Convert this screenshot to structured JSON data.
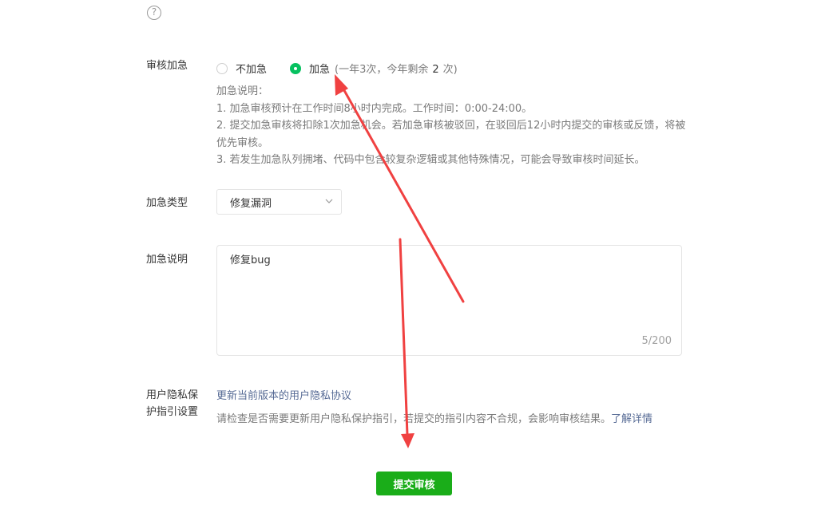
{
  "help_icon": "?",
  "urgent": {
    "label": "审核加急",
    "options": [
      {
        "label": "不加急",
        "checked": false
      },
      {
        "label": "加急",
        "checked": true
      }
    ],
    "quota_prefix": "(一年3次，今年剩余",
    "quota_count": "2",
    "quota_suffix": "次)",
    "desc_title": "加急说明：",
    "desc_lines": [
      "1. 加急审核预计在工作时间8小时内完成。工作时间：0:00-24:00。",
      "2. 提交加急审核将扣除1次加急机会。若加急审核被驳回，在驳回后12小时内提交的审核或反馈，将被优先审核。",
      "3. 若发生加急队列拥堵、代码中包含较复杂逻辑或其他特殊情况，可能会导致审核时间延长。"
    ]
  },
  "urgent_type": {
    "label": "加急类型",
    "value": "修复漏洞"
  },
  "urgent_desc": {
    "label": "加急说明",
    "value": "修复bug",
    "count": "5/200"
  },
  "privacy": {
    "label": "用户隐私保护指引设置",
    "link": "更新当前版本的用户隐私协议",
    "note": "请检查是否需要更新用户隐私保护指引，若提交的指引内容不合规，会影响审核结果。",
    "more_link": "了解详情"
  },
  "submit_label": "提交审核",
  "colors": {
    "accent_green": "#07c160",
    "button_green": "#1aad19",
    "link_blue": "#576b95",
    "annotation_red": "#f04141"
  }
}
